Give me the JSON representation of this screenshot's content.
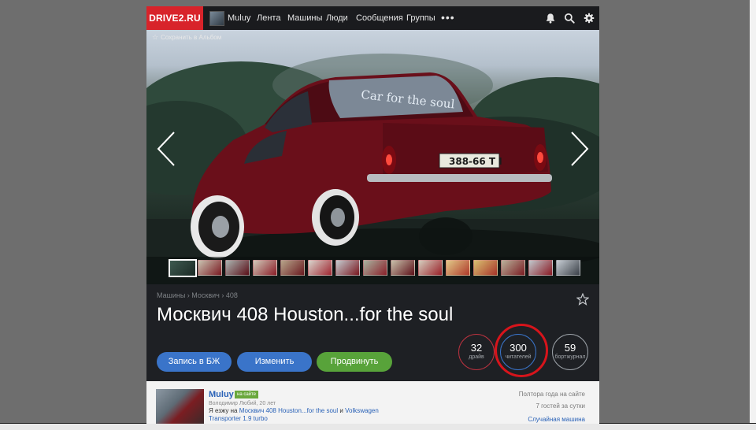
{
  "header": {
    "logo": "DRIVE2.RU",
    "user": "Muluy",
    "nav": [
      "Лента",
      "Машины",
      "Люди",
      "Сообщения",
      "Группы"
    ],
    "more": "•••"
  },
  "photo": {
    "save_label": "Сохранить в Альбом"
  },
  "car": {
    "breadcrumb": "Машины › Москвич › 408",
    "title": "Москвич 408 Houston...for the soul"
  },
  "actions": {
    "journal_button": "Запись в БЖ",
    "edit_button": "Изменить",
    "promote_button": "Продвинуть"
  },
  "stats": [
    {
      "value": "32",
      "label": "драйв"
    },
    {
      "value": "300",
      "label": "читателей"
    },
    {
      "value": "59",
      "label": "бортжурнал"
    }
  ],
  "owner": {
    "name": "Muluy",
    "badge": "на сайте",
    "details": "Володимир Любий, 20 лет",
    "drives_prefix": "Я езжу на",
    "car_link": "Москвич 408 Houston...for the soul",
    "and_word": "и",
    "car2_link_a": "Volkswagen",
    "car2_link_b": "Transporter 1.9 turbo",
    "since": "Полтора года на сайте",
    "guests": "7 гостей за сутки",
    "random_car": "Случайная машина"
  },
  "colors": {
    "brand_red": "#d8232a",
    "button_blue": "#3a74c9",
    "button_green": "#58a33a",
    "highlight_ring": "#d7141b"
  },
  "icons": {
    "bell": "bell-icon",
    "search": "search-icon",
    "settings": "gear-icon",
    "prev": "chevron-left-icon",
    "next": "chevron-right-icon",
    "bookmark": "star-icon"
  }
}
